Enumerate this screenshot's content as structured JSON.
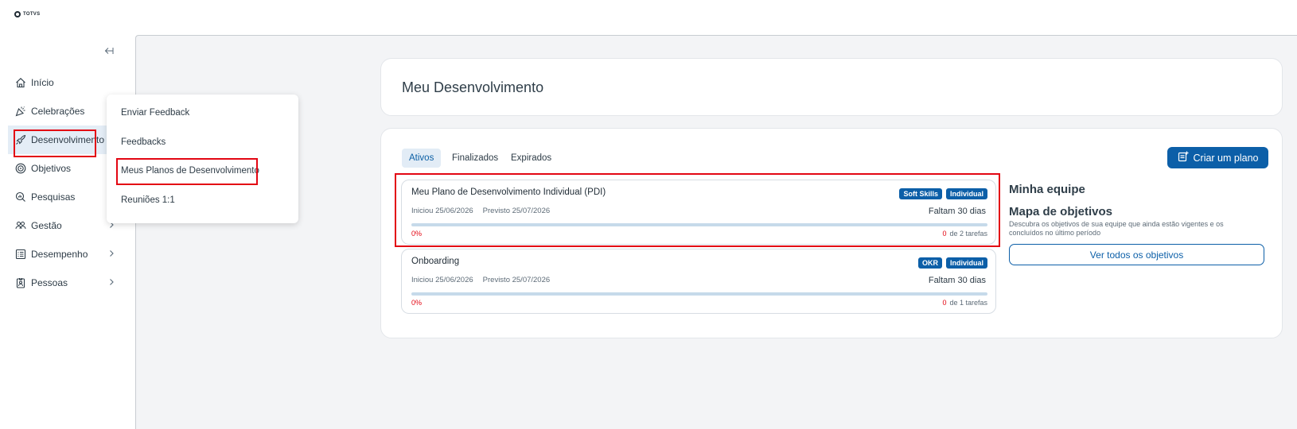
{
  "brand": {
    "name": "TOTVS"
  },
  "colors": {
    "accent": "#0c5fa8",
    "highlight": "#e30613",
    "active_bg": "#e4edf6"
  },
  "sidebar": {
    "collapse_icon": "arrow-collapse-left-icon",
    "items": [
      {
        "label": "Início",
        "icon": "home-icon"
      },
      {
        "label": "Celebrações",
        "icon": "party-popper-icon"
      },
      {
        "label": "Desenvolvimento",
        "icon": "rocket-icon",
        "active": true
      },
      {
        "label": "Objetivos",
        "icon": "target-icon"
      },
      {
        "label": "Pesquisas",
        "icon": "search-poll-icon"
      },
      {
        "label": "Gestão",
        "icon": "people-icon",
        "has_submenu": true
      },
      {
        "label": "Desempenho",
        "icon": "list-icon",
        "has_submenu": true
      },
      {
        "label": "Pessoas",
        "icon": "badge-icon",
        "has_submenu": true
      }
    ]
  },
  "flyout": {
    "items": [
      {
        "label": "Enviar Feedback"
      },
      {
        "label": "Feedbacks"
      },
      {
        "label": "Meus Planos de Desenvolvimento"
      },
      {
        "label": "Reuniões 1:1"
      }
    ]
  },
  "main": {
    "title": "Meu Desenvolvimento",
    "tabs": [
      {
        "label": "Ativos",
        "active": true
      },
      {
        "label": "Finalizados"
      },
      {
        "label": "Expirados"
      }
    ],
    "create_button": "Criar um plano",
    "plans": [
      {
        "title": "Meu Plano de Desenvolvimento Individual (PDI)",
        "started": "Iniciou 25/06/2026",
        "expected": "Previsto 25/07/2026",
        "badges": [
          "Soft Skills",
          "Individual"
        ],
        "remaining": "Faltam 30 dias",
        "progress_label": "0%",
        "progress": 0,
        "tasks_done": "0",
        "tasks_total": "de 2 tarefas"
      },
      {
        "title": "Onboarding",
        "started": "Iniciou 25/06/2026",
        "expected": "Previsto 25/07/2026",
        "badges": [
          "OKR",
          "Individual"
        ],
        "remaining": "Faltam 30 dias",
        "progress_label": "0%",
        "progress": 0,
        "tasks_done": "0",
        "tasks_total": "de 1 tarefas"
      }
    ],
    "team": {
      "title": "Minha equipe",
      "subtitle": "Mapa de objetivos",
      "description": "Descubra os objetivos de sua equipe que ainda estão vigentes e os concluídos no último período",
      "button": "Ver todos os objetivos"
    }
  }
}
